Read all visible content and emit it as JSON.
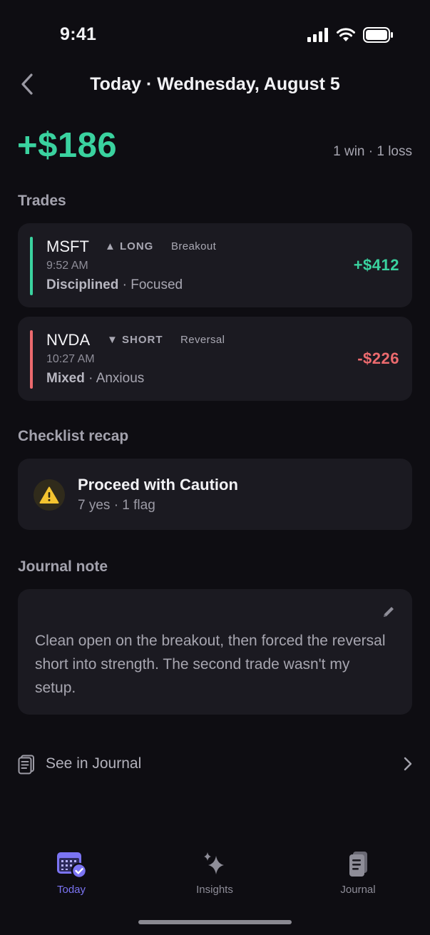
{
  "status": {
    "time": "9:41"
  },
  "nav": {
    "title": "Today · Wednesday, August 5"
  },
  "summary": {
    "pnl": "+$186",
    "record": "1 win · 1 loss"
  },
  "sections": {
    "trades": "Trades",
    "checklist": "Checklist recap",
    "journal": "Journal note"
  },
  "trades": [
    {
      "ticker": "MSFT",
      "direction": "▲ LONG",
      "tag": "Breakout",
      "time": "9:52 AM",
      "mood_primary": "Disciplined",
      "mood_secondary": " · Focused",
      "amount": "+$412",
      "color": "#3ad29f"
    },
    {
      "ticker": "NVDA",
      "direction": "▼ SHORT",
      "tag": "Reversal",
      "time": "10:27 AM",
      "mood_primary": "Mixed",
      "mood_secondary": " · Anxious",
      "amount": "-$226",
      "color": "#ec6a6e"
    }
  ],
  "checklist": {
    "title": "Proceed with Caution",
    "subtitle": "7 yes · 1 flag",
    "icon": "warning-icon",
    "accent": "#f4c430"
  },
  "journal_note": {
    "text": "Clean open on the breakout, then forced the reversal short into strength. The second trade wasn't my setup."
  },
  "links": {
    "see_journal": "See in Journal"
  },
  "tabs": [
    {
      "label": "Today",
      "icon": "calendar-check-icon",
      "active": true
    },
    {
      "label": "Insights",
      "icon": "sparkles-icon",
      "active": false
    },
    {
      "label": "Journal",
      "icon": "journal-icon",
      "active": false
    }
  ],
  "colors": {
    "accent": "#7b74f3",
    "gain": "#3ad29f",
    "loss": "#ec6a6e",
    "background": "#0e0d12",
    "card": "#1b1a21"
  }
}
